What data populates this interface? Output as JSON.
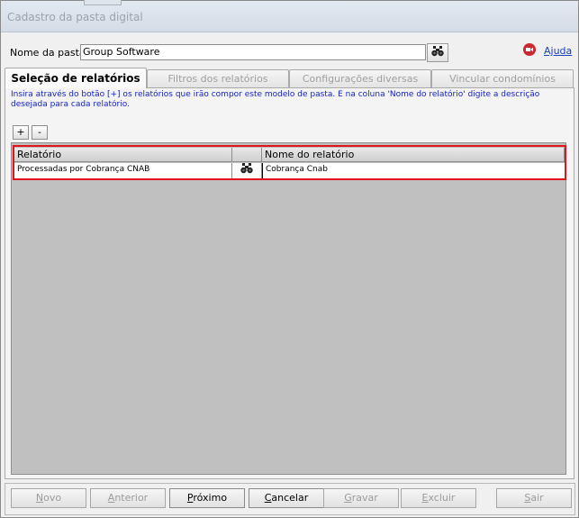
{
  "window": {
    "title": "Cadastro da pasta digital"
  },
  "form": {
    "name_label": "Nome da pasta:",
    "name_value": "Group Software",
    "search_icon": "binoculars-icon",
    "help_icon": "help-stop-icon",
    "help_label": "Ajuda"
  },
  "tabs": [
    {
      "label": "Seleção de relatórios",
      "active": true
    },
    {
      "label": "Filtros dos relatórios",
      "active": false
    },
    {
      "label": "Configurações diversas",
      "active": false
    },
    {
      "label": "Vincular condomínios",
      "active": false
    }
  ],
  "panel": {
    "hint": "Insira através do botão [+] os relatórios que irão compor este modelo de pasta. E na coluna 'Nome do relatório' digite a descrição desejada para cada relatório.",
    "add_label": "+",
    "remove_label": "-"
  },
  "grid": {
    "columns": [
      "Relatório",
      "",
      "Nome do relatório"
    ],
    "rows": [
      {
        "report": "Processadas por Cobrança CNAB",
        "lookup_icon": "binoculars-icon",
        "name": "Cobrança Cnab"
      }
    ]
  },
  "buttons": [
    {
      "first": "N",
      "rest": "ovo",
      "enabled": false
    },
    {
      "first": "A",
      "rest": "nterior",
      "enabled": false
    },
    {
      "first": "P",
      "rest": "róximo",
      "enabled": true
    },
    {
      "first": "C",
      "rest": "ancelar",
      "enabled": true
    },
    {
      "first": "G",
      "rest": "ravar",
      "enabled": false
    },
    {
      "first": "E",
      "rest": "xcluir",
      "enabled": false
    },
    {
      "first": "S",
      "rest": "air",
      "enabled": false
    }
  ],
  "colors": {
    "highlight": "#e1141c",
    "hint_text": "#1522c9",
    "link": "#1a3fb8"
  }
}
